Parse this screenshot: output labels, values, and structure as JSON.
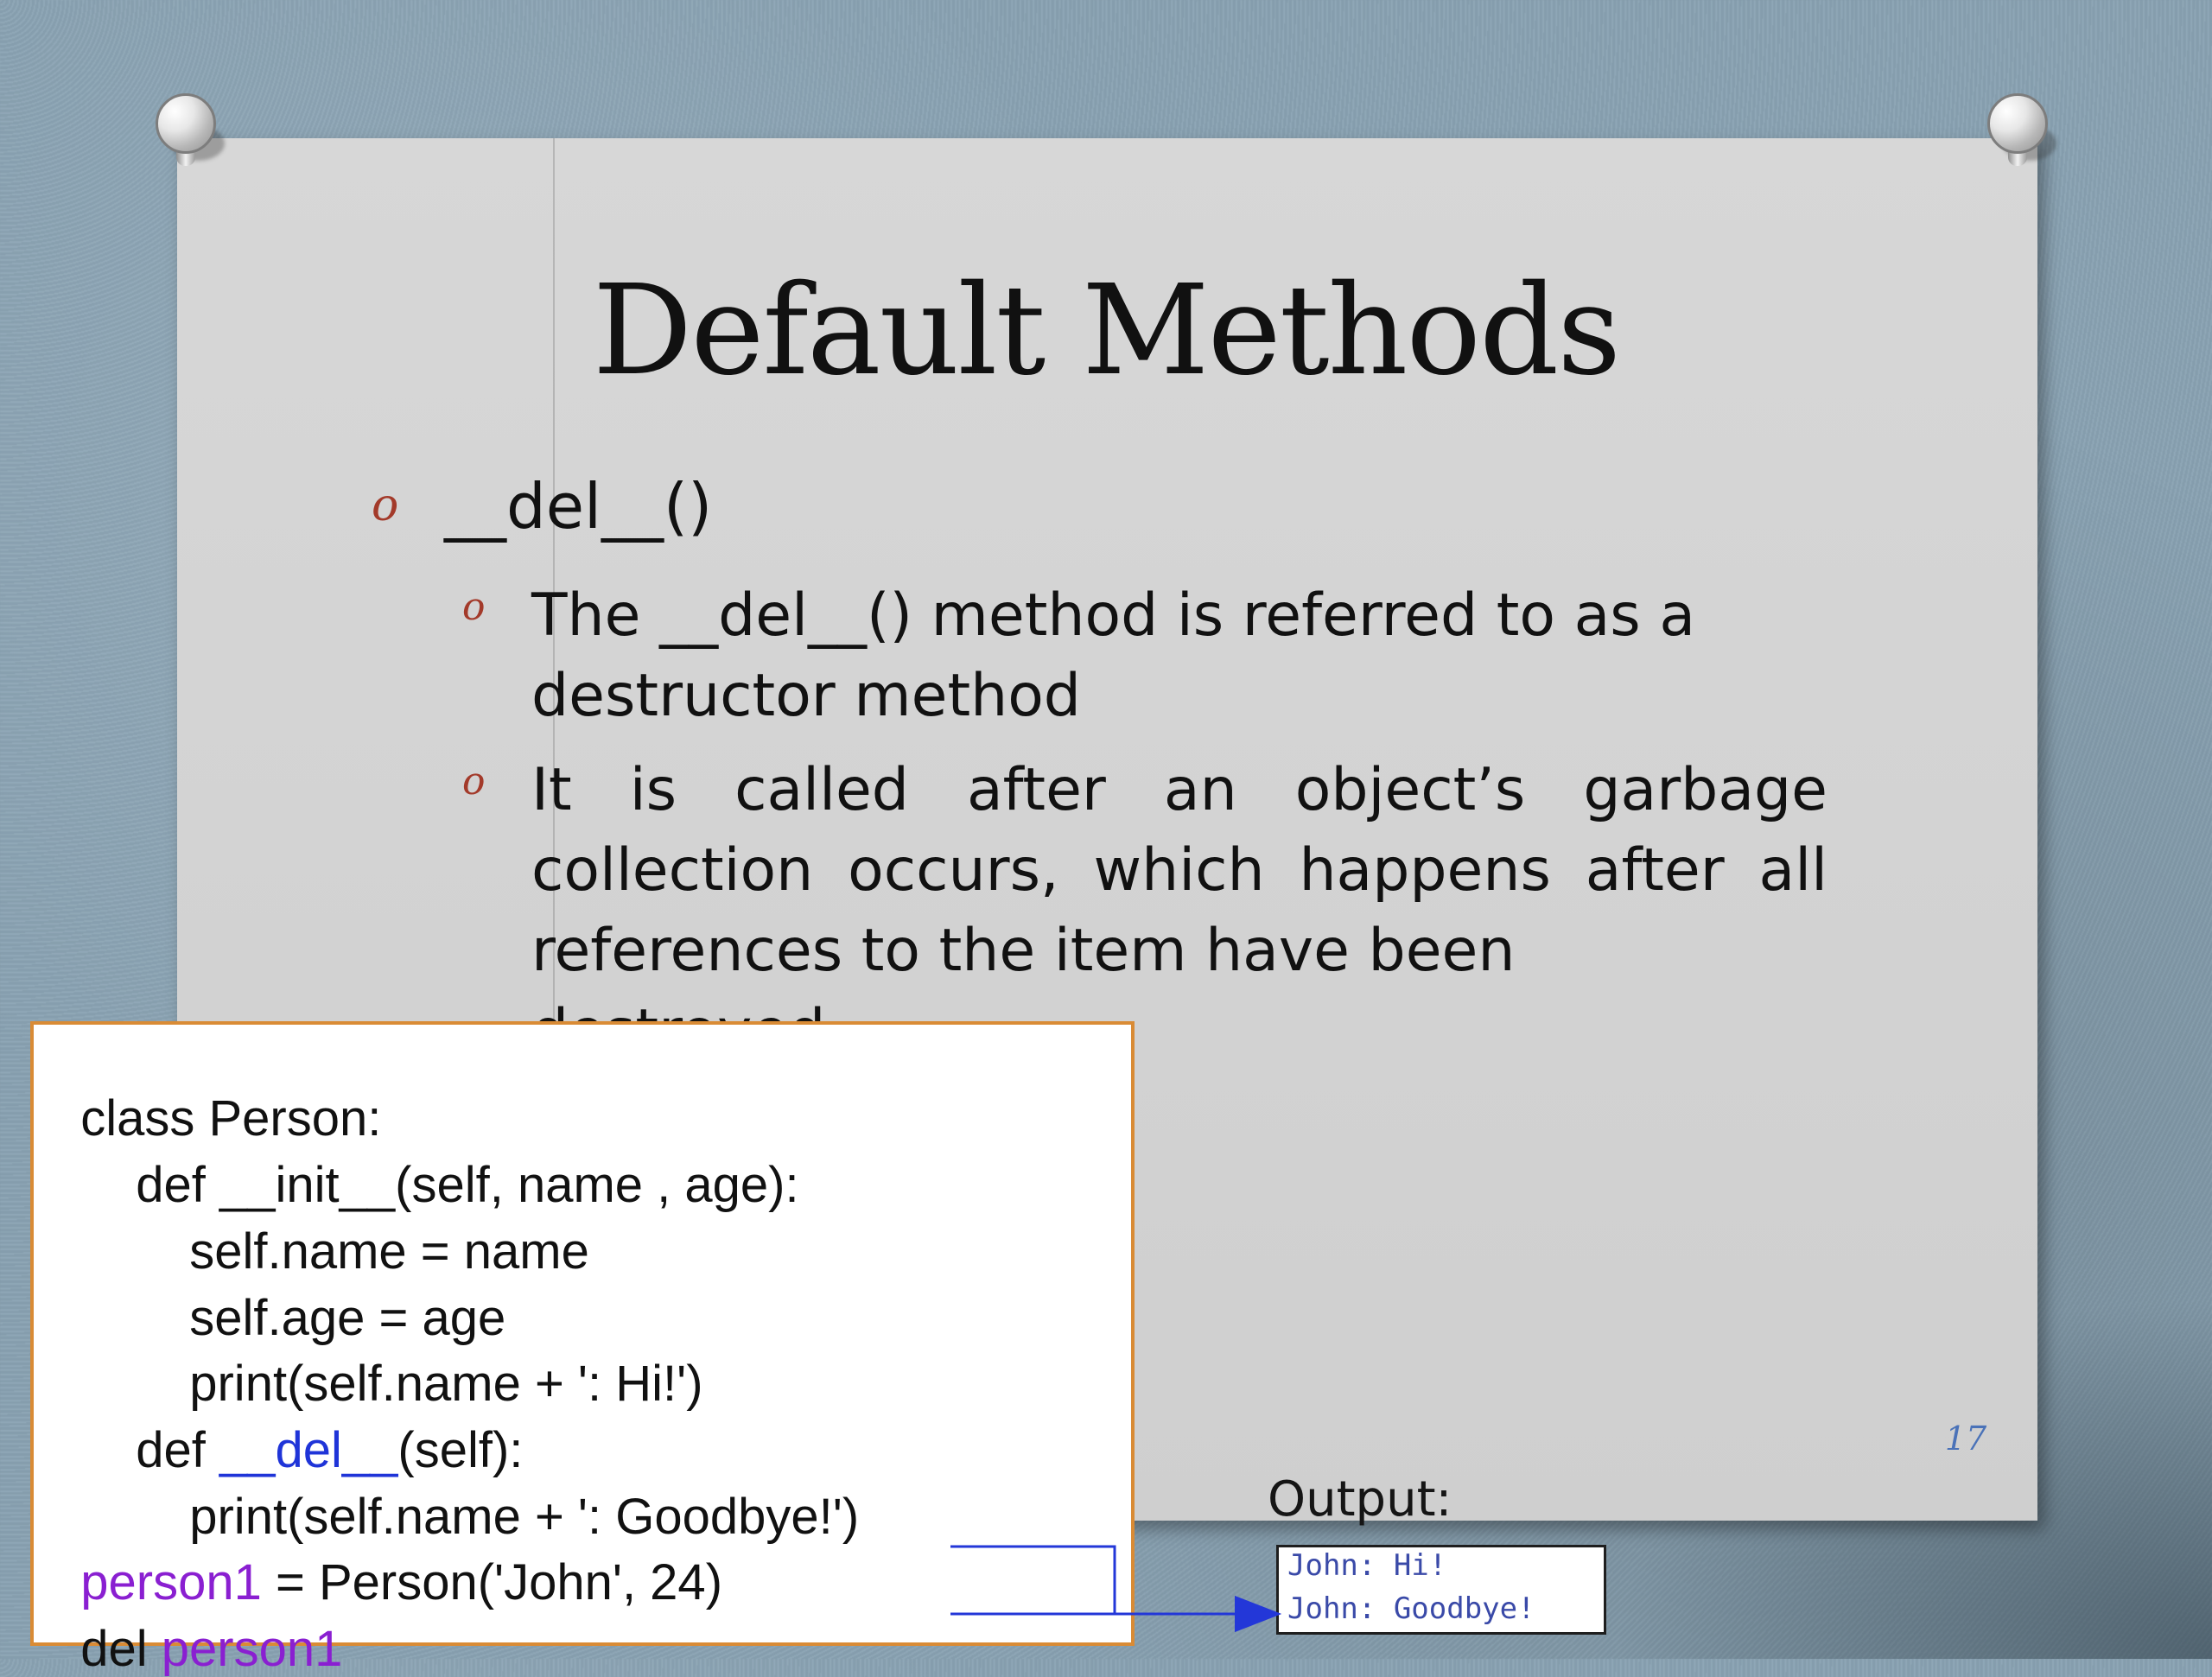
{
  "slide": {
    "title": "Default Methods",
    "main_bullet": "__del__()",
    "sub_bullets": [
      {
        "lines": [
          "The __del__() method is referred to as a",
          "destructor method"
        ]
      },
      {
        "lines": [
          "It is called after an object’s garbage",
          "collection occurs, which happens after all",
          "references to the item have been destroyed."
        ]
      }
    ],
    "page_number": "17"
  },
  "code": {
    "lines": [
      [
        "class Person:"
      ],
      [
        "def __init__(self, name , age):"
      ],
      [
        "self.name = name"
      ],
      [
        "self.age = age"
      ],
      [
        "print(self.name + ': Hi!')"
      ],
      [
        "def ",
        "__del__",
        "(self):"
      ],
      [
        "print(self.name + ': Goodbye!')"
      ],
      [
        "person1",
        " = Person('John', 24)"
      ],
      [
        "del ",
        "person1"
      ]
    ]
  },
  "output": {
    "label": "Output:",
    "lines": [
      "John: Hi!",
      "John: Goodbye!"
    ]
  },
  "colors": {
    "accent_red": "#a33a2a",
    "code_blue": "#1f34d8",
    "code_purple": "#8a1fd1",
    "output_blue": "#3a4aa8",
    "code_border": "#d98b35"
  },
  "icons": {
    "pin": "pushpin-icon",
    "bullet": "bullet-o-icon"
  }
}
